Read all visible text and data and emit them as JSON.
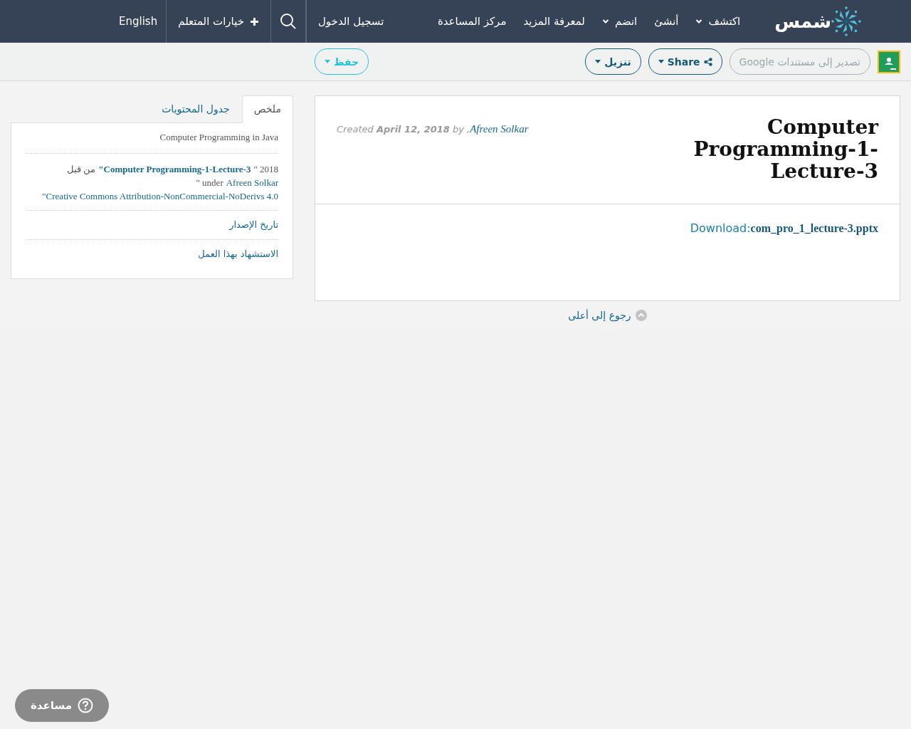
{
  "nav": {
    "logo": "شمس",
    "items": [
      {
        "label": "اكتشف",
        "dropdown": true
      },
      {
        "label": "أنشئ",
        "dropdown": false
      },
      {
        "label": "انضم",
        "dropdown": true
      },
      {
        "label": "لمعرفة المزيد",
        "dropdown": false
      },
      {
        "label": "مركز المساعدة",
        "dropdown": false
      }
    ],
    "login": "تسجيل الدخول",
    "learner_options": "خيارات المتعلم",
    "language": "English"
  },
  "toolbar": {
    "export": {
      "label": "تصدير إلى مستندات Google",
      "disabled": true
    },
    "share": "Share",
    "download": "تنزيل",
    "save": "حفظ"
  },
  "resource": {
    "title": "Computer Programming-1-Lecture-3",
    "meta": "Created **April 12, 2018** by ,",
    "author": "Afreen Solkar",
    "download_label": "Download:",
    "file": "com_pro_1_lecture-3.pptx"
  },
  "back_to_top": "رجوع إلى أعلى",
  "sidebar": {
    "tabs": [
      {
        "label": "ملخص",
        "selected": true
      },
      {
        "label": "جدول المحتويات",
        "selected": false
      }
    ],
    "description": "Computer Programming in Java",
    "attribution": [
      {
        "kind": "text",
        "text": "2018 \""
      },
      {
        "kind": "bold_link",
        "text": "Computer Programming-1-Lecture-3\""
      },
      {
        "kind": "text",
        "text": " من قبل "
      },
      {
        "kind": "link",
        "text": "Afreen Solkar"
      },
      {
        "kind": "text",
        "text": " under \""
      },
      {
        "kind": "link",
        "text": "Creative Commons Attribution-NonCommercial-NoDerivs 4.0\""
      }
    ],
    "links": [
      "تاريخ الإصدار",
      "الاستشهاد بهذا العمل"
    ]
  },
  "help": "مساعدة"
}
